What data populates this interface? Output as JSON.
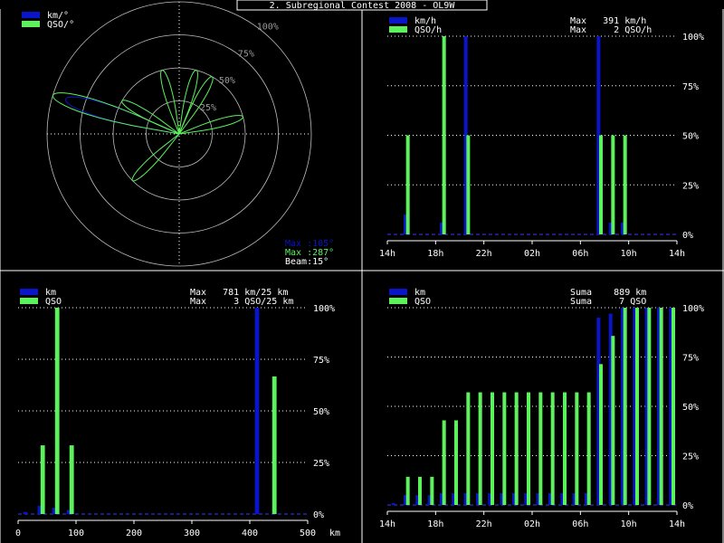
{
  "title": "2. Subregional Contest 2008 - OL9W",
  "colors": {
    "km": "#0a14c8",
    "qso": "#5cf25c",
    "grid": "#ffffff",
    "frame": "#ffffff",
    "zero_line": "#3a3aff"
  },
  "chart_data": [
    {
      "id": "polar",
      "type": "polar",
      "legend": [
        "km/°",
        "QSO/°"
      ],
      "ring_labels": [
        "100%",
        "75%",
        "50%",
        "25%"
      ],
      "max_km_label": "Max :105°",
      "max_qso_label": "Max :287°",
      "beam_label": "Beam:15°",
      "beam_width_deg": 15,
      "km_petals": [
        {
          "az": 287,
          "r": 1.0
        }
      ],
      "qso_petals": [
        {
          "az": 287,
          "r": 1.0
        },
        {
          "az": 345,
          "r": 0.5
        },
        {
          "az": 15,
          "r": 0.5
        },
        {
          "az": 30,
          "r": 0.5
        },
        {
          "az": 75,
          "r": 0.5
        },
        {
          "az": 300,
          "r": 0.5
        },
        {
          "az": 225,
          "r": 0.5
        }
      ]
    },
    {
      "id": "by_hour",
      "type": "bar",
      "legend": [
        "km/h",
        "QSO/h"
      ],
      "max_lines": [
        "Max   391 km/h",
        "Max     2 QSO/h"
      ],
      "y_ticks": [
        "100%",
        "75%",
        "50%",
        "25%",
        "0%"
      ],
      "x_ticks": [
        "14h",
        "18h",
        "22h",
        "02h",
        "06h",
        "10h",
        "14h"
      ],
      "slots": 24,
      "km": [
        0,
        0.1,
        0,
        0,
        0.06,
        0,
        1.0,
        0,
        0,
        0,
        0,
        0,
        0,
        0,
        0,
        0,
        0,
        1.0,
        0.06,
        0.06,
        0,
        0,
        0,
        0
      ],
      "qso": [
        0,
        0.5,
        0,
        0,
        1.0,
        0,
        0.5,
        0,
        0,
        0,
        0,
        0,
        0,
        0,
        0,
        0,
        0,
        0.5,
        0.5,
        0.5,
        0,
        0,
        0,
        0
      ]
    },
    {
      "id": "by_distance",
      "type": "bar",
      "legend": [
        "km",
        "QSO"
      ],
      "max_lines": [
        "Max   781 km/25 km",
        "Max     3 QSO/25 km"
      ],
      "y_ticks": [
        "100%",
        "75%",
        "50%",
        "25%",
        "0%"
      ],
      "x_ticks": [
        "0",
        "100",
        "200",
        "300",
        "400",
        "500"
      ],
      "x_unit": "km",
      "slots": 20,
      "km": [
        0.01,
        0.04,
        0.03,
        0.02,
        0,
        0,
        0,
        0,
        0,
        0,
        0,
        0,
        0,
        0,
        0,
        0,
        1.0,
        0,
        0,
        0
      ],
      "qso": [
        0,
        0.333,
        1.0,
        0.333,
        0,
        0,
        0,
        0,
        0,
        0,
        0,
        0,
        0,
        0,
        0,
        0,
        0,
        0.667,
        0,
        0
      ]
    },
    {
      "id": "cumulative",
      "type": "bar",
      "legend": [
        "km",
        "QSO"
      ],
      "max_lines": [
        "Suma    889 km",
        "Suma     7 QSO"
      ],
      "y_ticks": [
        "100%",
        "75%",
        "50%",
        "25%",
        "0%"
      ],
      "x_ticks": [
        "14h",
        "18h",
        "22h",
        "02h",
        "06h",
        "10h",
        "14h"
      ],
      "slots": 24,
      "km": [
        0.01,
        0.05,
        0.05,
        0.05,
        0.06,
        0.06,
        0.06,
        0.06,
        0.06,
        0.06,
        0.06,
        0.06,
        0.06,
        0.06,
        0.06,
        0.06,
        0.06,
        0.95,
        0.97,
        1.0,
        1.0,
        1.0,
        1.0,
        1.0
      ],
      "qso": [
        0,
        0.143,
        0.143,
        0.143,
        0.429,
        0.429,
        0.571,
        0.571,
        0.571,
        0.571,
        0.571,
        0.571,
        0.571,
        0.571,
        0.571,
        0.571,
        0.571,
        0.714,
        0.857,
        1.0,
        1.0,
        1.0,
        1.0,
        1.0
      ]
    }
  ]
}
